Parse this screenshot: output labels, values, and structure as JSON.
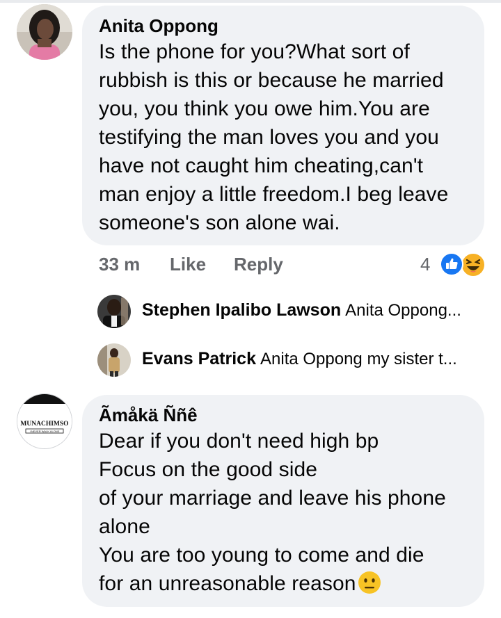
{
  "comment1": {
    "author": "Anita Oppong",
    "text": "Is the phone for you?What sort of\nrubbish is this or because he married\nyou, you think you owe him.You are\ntestifying the man loves you and you\nhave not caught him cheating,can't\nman enjoy a little freedom.I beg leave\nsomeone's son alone wai."
  },
  "actions": {
    "time": "33 m",
    "like_label": "Like",
    "reply_label": "Reply",
    "reaction_count": "4",
    "reaction_icons": [
      "like-icon",
      "haha-icon"
    ],
    "like_color": "#1877f2",
    "haha_color": "#f7b125"
  },
  "replies": [
    {
      "author": "Stephen Ipalibo Lawson",
      "preview": "Anita Oppong..."
    },
    {
      "author": "Evans Patrick",
      "preview": "Anita Oppong my sister t..."
    }
  ],
  "comment2": {
    "author": "Ãmåkä Ññê",
    "text": "Dear if you don't need high bp\nFocus on the good side\nof your marriage and leave his phone\nalone\nYou are too young to come and die\nfor an unreasonable reason",
    "trailing_emoji": "neutral-face-icon",
    "avatar_logo_text": "MUNACHIMSO",
    "avatar_logo_subtext": "I NEVER WALK ALONE"
  }
}
